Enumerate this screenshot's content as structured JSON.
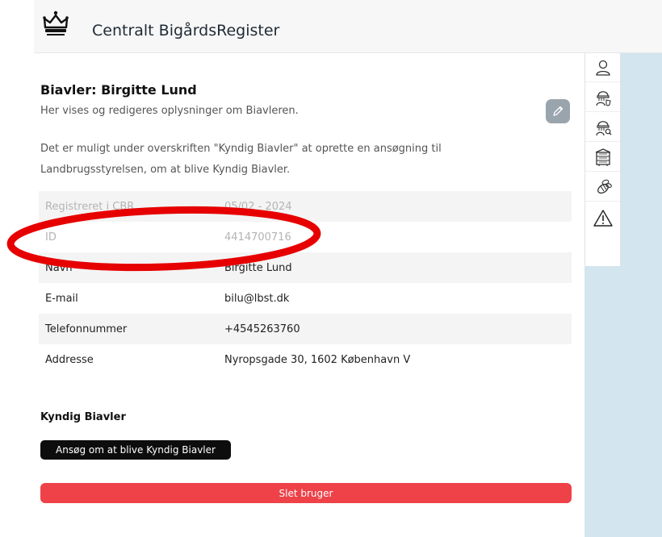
{
  "header": {
    "title": "Centralt BigårdsRegister",
    "logo_icon": "crown-icon"
  },
  "profile": {
    "title": "Biavler: Birgitte Lund",
    "subtitle": "Her vises og redigeres oplysninger om Biavleren.",
    "description": "Det er muligt under overskriften \"Kyndig Biavler\" at oprette en ansøgning til Landbrugsstyrelsen, om at blive Kyndig Biavler."
  },
  "details": [
    {
      "label": "Registreret i CBR",
      "value": "05/02 - 2024"
    },
    {
      "label": "ID",
      "value": "4414700716"
    },
    {
      "label": "Navn",
      "value": "Birgitte Lund"
    },
    {
      "label": "E-mail",
      "value": "bilu@lbst.dk"
    },
    {
      "label": "Telefonnummer",
      "value": "+4545263760"
    },
    {
      "label": "Addresse",
      "value": "Nyropsgade 30, 1602 København V"
    }
  ],
  "kyndig": {
    "heading": "Kyndig Biavler",
    "apply_label": "Ansøg om at blive Kyndig Biavler"
  },
  "delete_label": "Slet bruger",
  "sidebar_icons": [
    "person-icon",
    "beekeeper-shield-icon",
    "beekeeper-search-icon",
    "beehive-icon",
    "bee-icon",
    "warning-icon"
  ],
  "colors": {
    "delete": "#ee4248",
    "apply": "#0d0d0d",
    "annotation": "#e60000",
    "panel": "#d3e5ef"
  }
}
